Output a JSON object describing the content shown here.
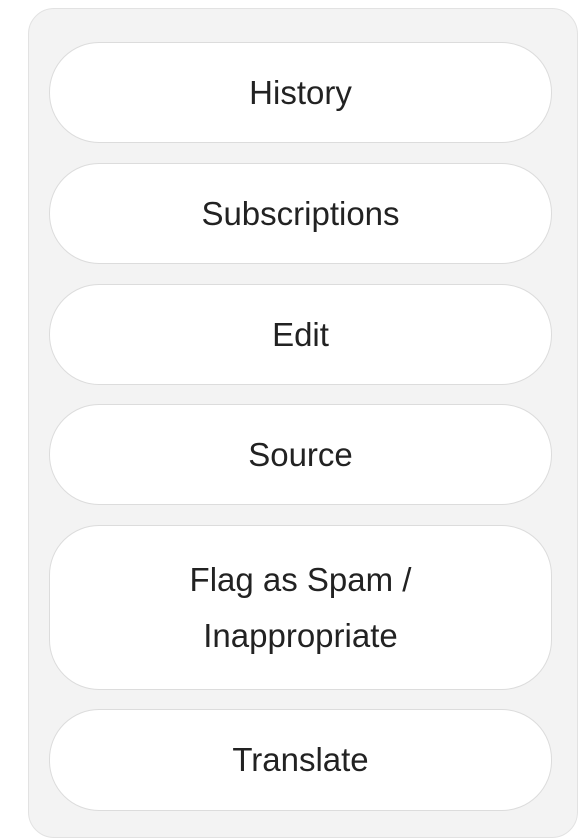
{
  "actions_panel": {
    "history_label": "History",
    "subscriptions_label": "Subscriptions",
    "edit_label": "Edit",
    "source_label": "Source",
    "flag_label": "Flag as Spam / Inappropriate",
    "translate_label": "Translate"
  },
  "colors": {
    "panel_background": "#f3f3f3",
    "button_background": "#ffffff",
    "button_border": "#dcdcdc",
    "text": "#222222"
  }
}
